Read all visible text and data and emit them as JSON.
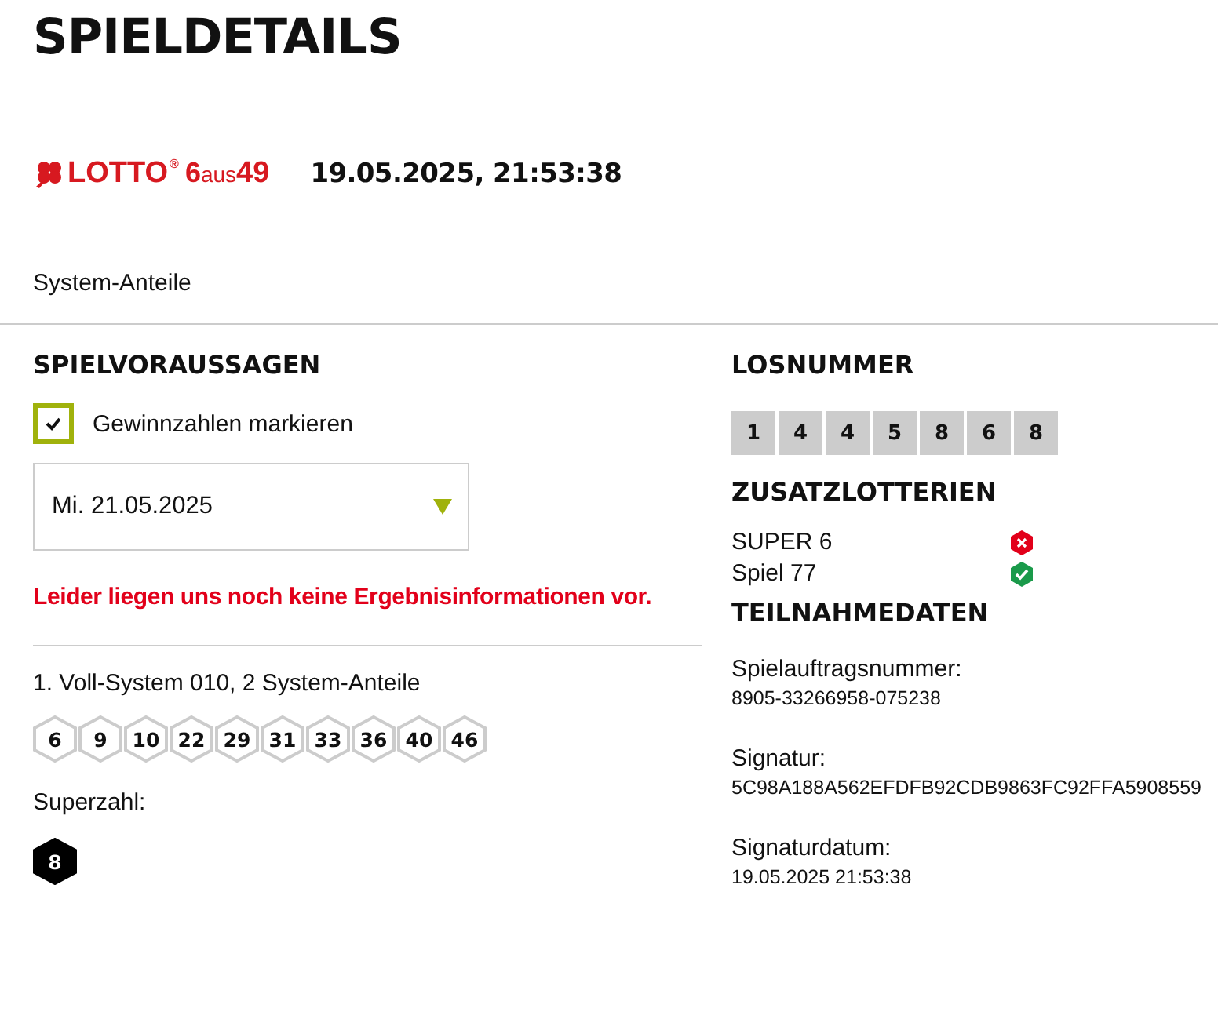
{
  "title": "SPIELDETAILS",
  "logo": {
    "brand": "LOTTO",
    "registered": "®",
    "six": "6",
    "aus": "aus",
    "fortynine": "49"
  },
  "datetime": "19.05.2025, 21:53:38",
  "subtitle": "System-Anteile",
  "predictions": {
    "heading": "SPIELVORAUSSAGEN",
    "checkbox": {
      "label": "Gewinnzahlen markieren",
      "checked": true
    },
    "date_select": {
      "value": "Mi. 21.05.2025"
    },
    "notice": "Leider liegen uns noch keine Ergebnisinformationen vor.",
    "system": "1. Voll-System 010, 2 System-Anteile",
    "numbers": [
      "6",
      "9",
      "10",
      "22",
      "29",
      "31",
      "33",
      "36",
      "40",
      "46"
    ],
    "superzahl_label": "Superzahl:",
    "superzahl": "8"
  },
  "ticket": {
    "heading": "LOSNUMMER",
    "digits": [
      "1",
      "4",
      "4",
      "5",
      "8",
      "6",
      "8"
    ]
  },
  "extra": {
    "heading": "ZUSATZLOTTERIEN",
    "items": [
      {
        "name": "SUPER 6",
        "participating": false
      },
      {
        "name": "Spiel 77",
        "participating": true
      }
    ]
  },
  "participation": {
    "heading": "TEILNAHMEDATEN",
    "fields": [
      {
        "label": "Spielauftragsnummer:",
        "value": "8905-33266958-075238"
      },
      {
        "label": "Signatur:",
        "value": "5C98A188A562EFDFB92CDB9863FC92FFA5908559"
      },
      {
        "label": "Signaturdatum:",
        "value": "19.05.2025 21:53:38"
      }
    ]
  }
}
